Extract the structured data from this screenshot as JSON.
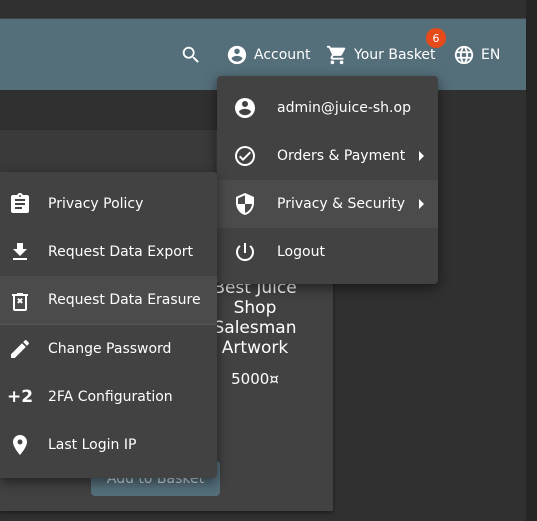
{
  "toolbar": {
    "account_label": "Account",
    "basket_label": "Your Basket",
    "basket_count": "6",
    "language_label": "EN"
  },
  "account_menu": {
    "items": [
      {
        "label": "admin@juice-sh.op",
        "icon": "account-circle-icon"
      },
      {
        "label": "Orders & Payment",
        "icon": "check-circle-icon"
      },
      {
        "label": "Privacy & Security",
        "icon": "security-shield-icon"
      },
      {
        "label": "Logout",
        "icon": "power-icon"
      }
    ]
  },
  "privacy_menu": {
    "items": [
      {
        "label": "Privacy Policy",
        "icon": "clipboard-icon"
      },
      {
        "label": "Request Data Export",
        "icon": "download-icon"
      },
      {
        "label": "Request Data Erasure",
        "icon": "delete-icon"
      },
      {
        "label": "Change Password",
        "icon": "pencil-icon"
      },
      {
        "label": "2FA Configuration",
        "icon": "plus-two-icon",
        "icon_text": "+2"
      },
      {
        "label": "Last Login IP",
        "icon": "location-pin-icon"
      }
    ]
  },
  "product": {
    "name_lines": [
      "Best Juice",
      "Shop",
      "Salesman",
      "Artwork"
    ],
    "price": "5000¤",
    "add_to_basket": "Add to Basket"
  },
  "colors": {
    "toolbar": "#546e7a",
    "menu_bg": "#424242",
    "badge": "#e64a19",
    "page_bg": "#303030"
  }
}
